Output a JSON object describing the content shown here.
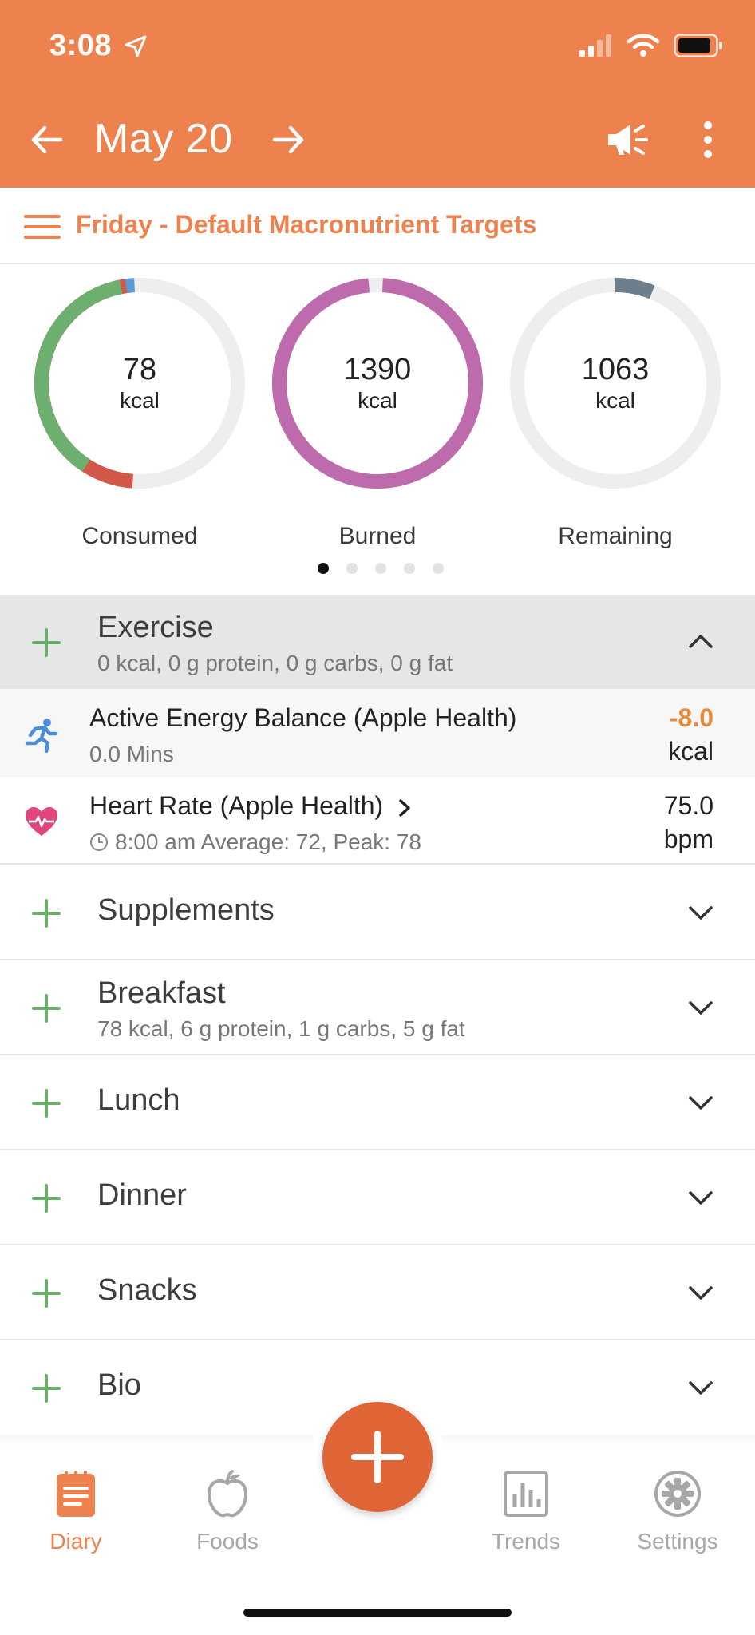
{
  "status_bar": {
    "time": "3:08"
  },
  "nav": {
    "date": "May 20"
  },
  "targets": {
    "label": "Friday - Default Macronutrient Targets"
  },
  "rings": [
    {
      "value": "78",
      "unit": "kcal",
      "label": "Consumed"
    },
    {
      "value": "1390",
      "unit": "kcal",
      "label": "Burned"
    },
    {
      "value": "1063",
      "unit": "kcal",
      "label": "Remaining"
    }
  ],
  "pager": {
    "total": 5,
    "active": 1
  },
  "exercise": {
    "title": "Exercise",
    "summary": "0 kcal, 0 g protein, 0 g carbs, 0 g fat",
    "entries": [
      {
        "title": "Active Energy Balance (Apple Health)",
        "sub": "0.0 Mins",
        "value": "-8.0",
        "unit": "kcal"
      },
      {
        "title": "Heart Rate (Apple Health)",
        "sub": "8:00 am Average: 72, Peak: 78",
        "value": "75.0",
        "unit": "bpm"
      }
    ]
  },
  "sections": [
    {
      "title": "Supplements",
      "summary": ""
    },
    {
      "title": "Breakfast",
      "summary": "78 kcal, 6 g protein, 1 g carbs, 5 g fat"
    },
    {
      "title": "Lunch",
      "summary": ""
    },
    {
      "title": "Dinner",
      "summary": ""
    },
    {
      "title": "Snacks",
      "summary": ""
    },
    {
      "title": "Bio",
      "summary": ""
    }
  ],
  "tabs": [
    {
      "label": "Diary",
      "icon": "diary-icon",
      "active": true
    },
    {
      "label": "Foods",
      "icon": "apple-icon",
      "active": false
    },
    {
      "label": "Trends",
      "icon": "bar-chart-icon",
      "active": false
    },
    {
      "label": "Settings",
      "icon": "gear-icon",
      "active": false
    }
  ],
  "colors": {
    "accent": "#EE824E",
    "fab": "#DF6436",
    "plus_green": "#6AAE6A",
    "ring_protein": "#6CAF6E",
    "ring_fat": "#D2584A",
    "ring_carbs": "#5B9BD5",
    "ring_burned": "#BD6BAD",
    "ring_remaining_fill": "#6D7F8C",
    "ring_track": "#EEEEEE",
    "negative_value": "#E38B3B"
  }
}
